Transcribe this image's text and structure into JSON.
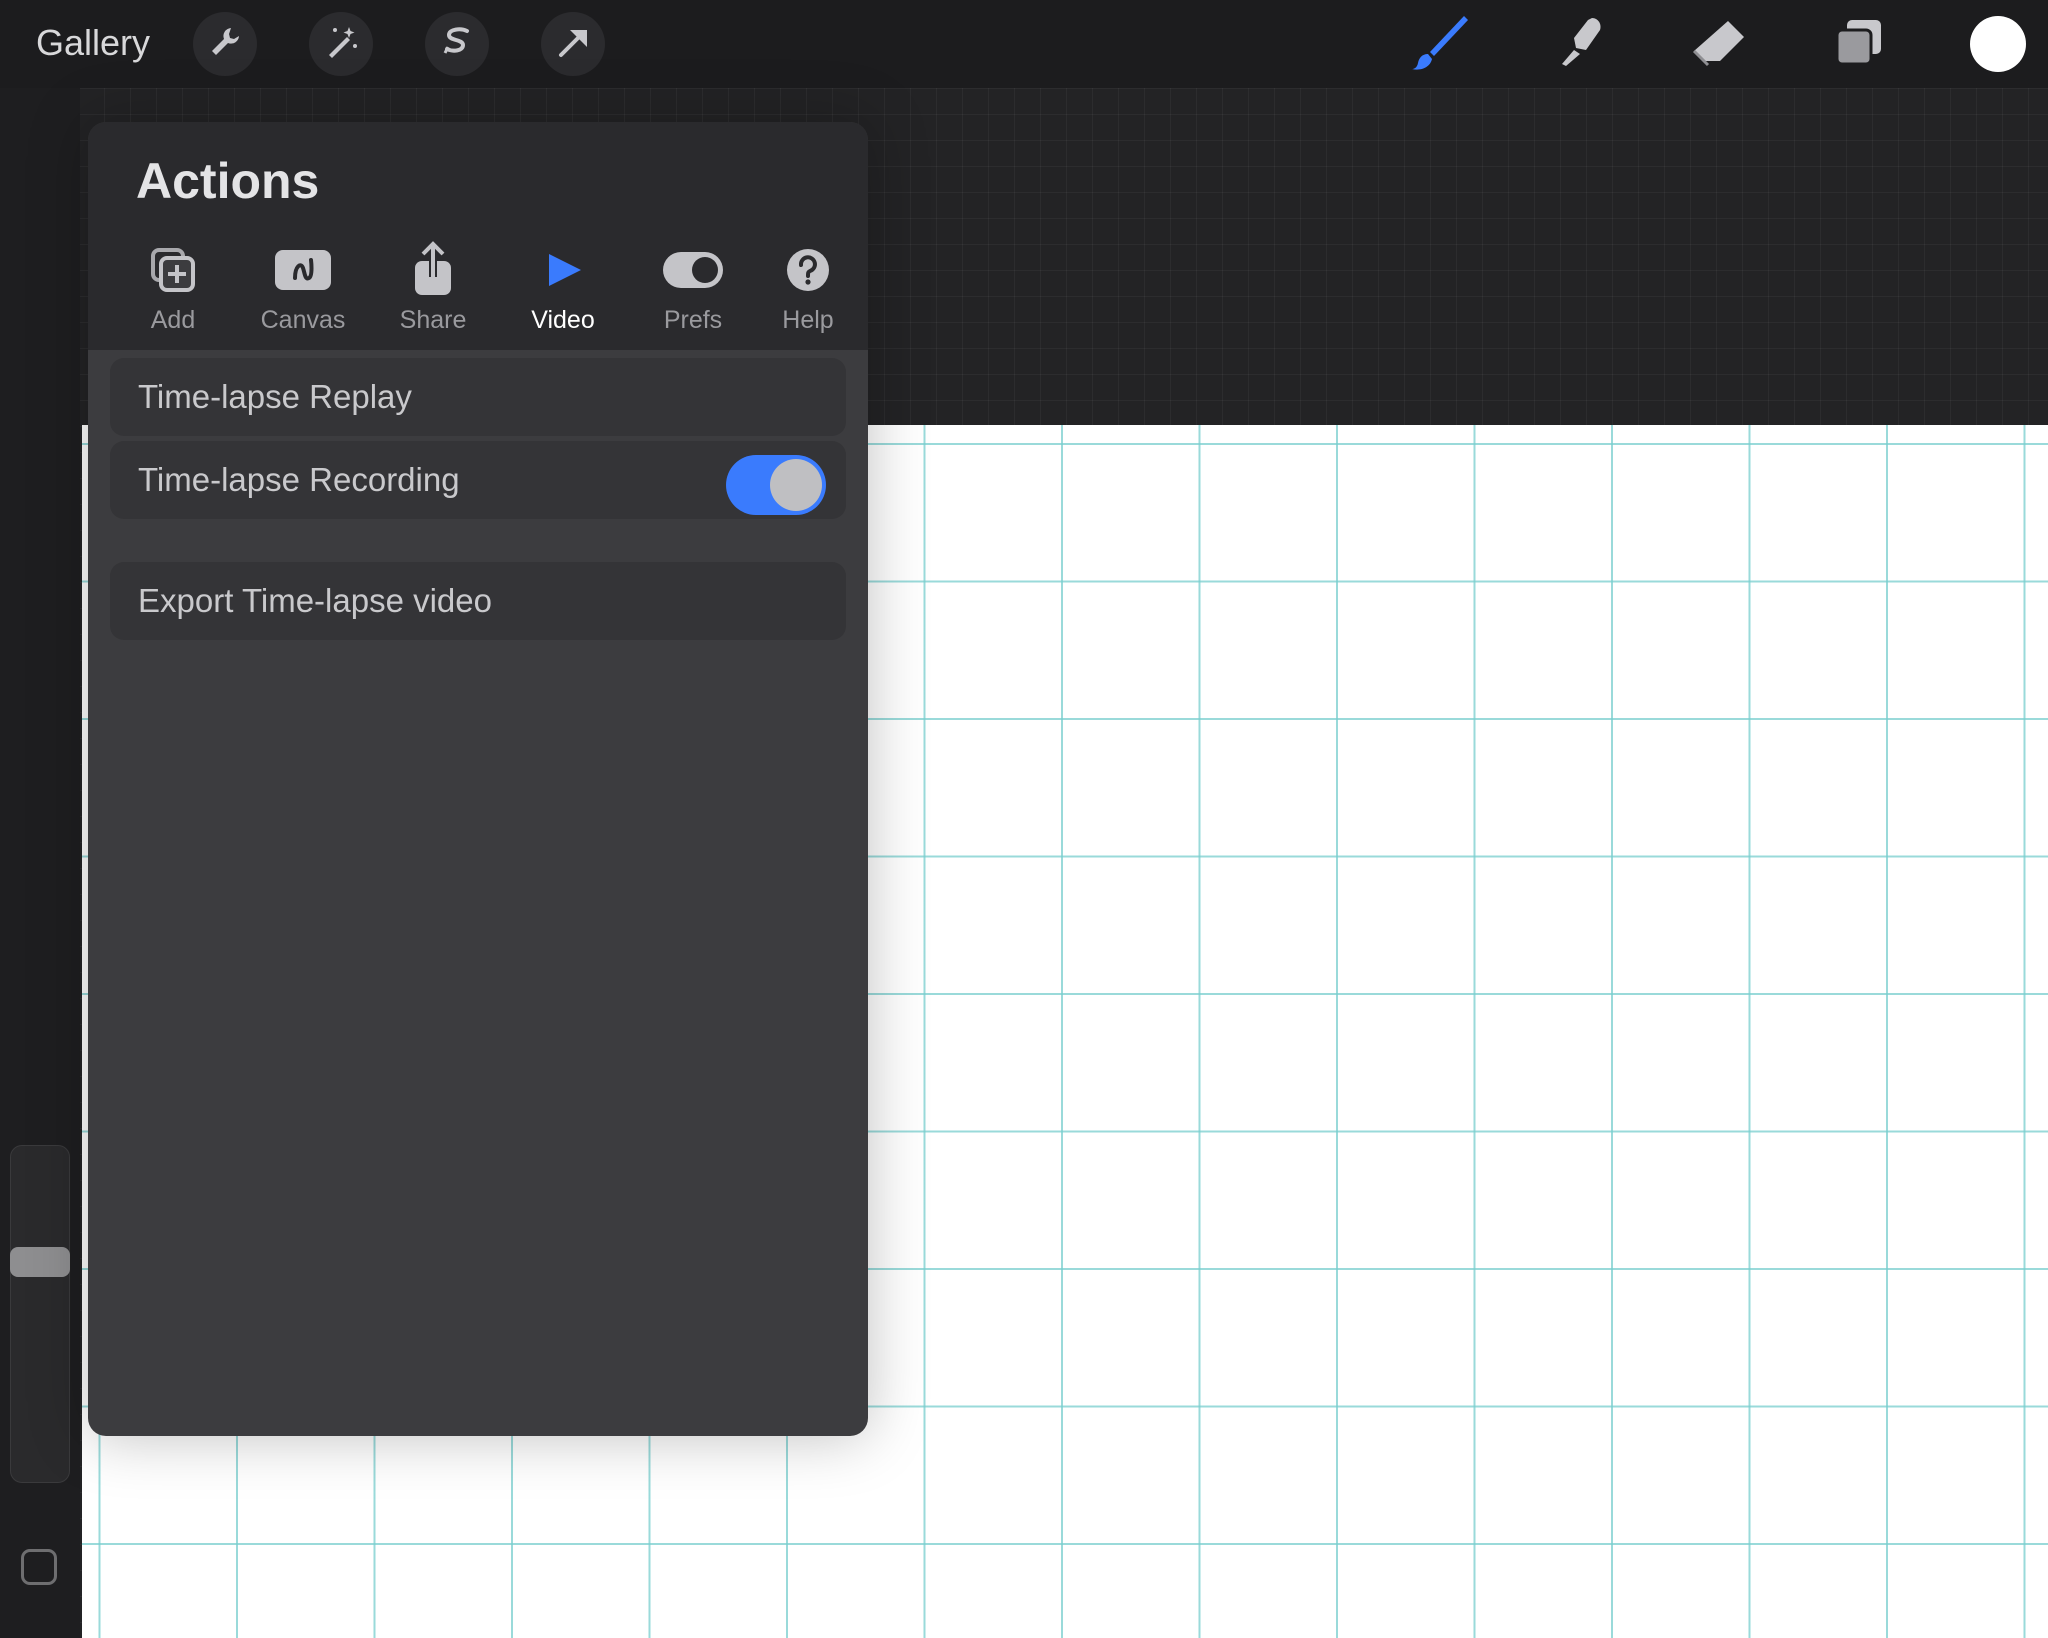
{
  "topbar": {
    "gallery_label": "Gallery",
    "left_tools": [
      "wrench-icon",
      "magic-wand-icon",
      "selection-icon",
      "transform-arrow-icon"
    ],
    "right_tools": [
      "brush-icon",
      "smudge-icon",
      "eraser-icon",
      "layers-icon"
    ],
    "active_tool": "brush-icon",
    "current_color": "#ffffff",
    "accent_color": "#3a7bfd"
  },
  "actions": {
    "title": "Actions",
    "tabs": [
      {
        "label": "Add",
        "icon": "add-icon"
      },
      {
        "label": "Canvas",
        "icon": "canvas-icon"
      },
      {
        "label": "Share",
        "icon": "share-icon"
      },
      {
        "label": "Video",
        "icon": "play-icon",
        "active": true
      },
      {
        "label": "Prefs",
        "icon": "toggle-icon"
      },
      {
        "label": "Help",
        "icon": "help-icon"
      }
    ],
    "items": {
      "replay": "Time-lapse Replay",
      "recording": "Time-lapse Recording",
      "recording_on": true,
      "export": "Export Time-lapse video"
    }
  }
}
